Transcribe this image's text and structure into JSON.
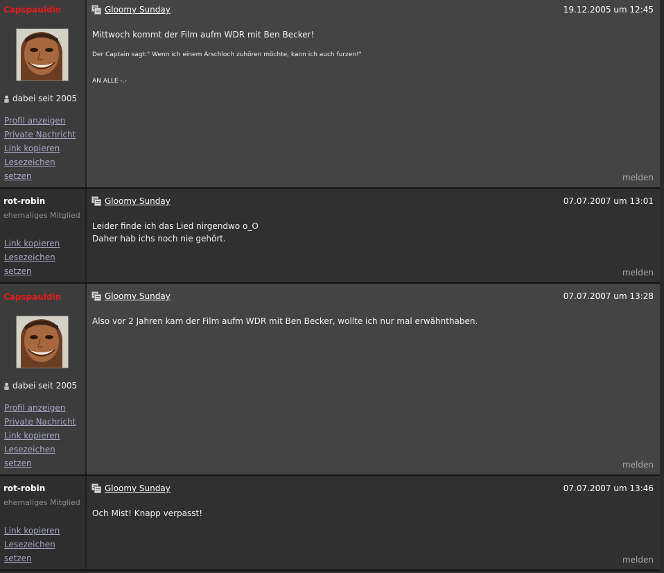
{
  "posts": [
    {
      "author": "Capspauldin",
      "since": "dabei seit 2005",
      "links": [
        "Profil anzeigen",
        "Private Nachricht",
        "Link kopieren",
        "Lesezeichen setzen"
      ],
      "title": "Gloomy Sunday",
      "date": "19.12.2005 um 12:45",
      "body": [
        "Mittwoch kommt der Film aufm WDR mit Ben Becker!",
        "Der Captain sagt:\" Wenn ich einem Arschloch zuhören möchte, kann ich auch furzen!\"",
        "AN ALLE -.-"
      ],
      "report": "melden"
    },
    {
      "author": "rot-robin",
      "role": "ehemaliges Mitglied",
      "links": [
        "Link kopieren",
        "Lesezeichen setzen"
      ],
      "title": "Gloomy Sunday",
      "date": "07.07.2007 um 13:01",
      "body": [
        "Leider finde ich das Lied nirgendwo o_O",
        "Daher hab ichs noch nie gehört."
      ],
      "report": "melden"
    },
    {
      "author": "Capspauldin",
      "since": "dabei seit 2005",
      "links": [
        "Profil anzeigen",
        "Private Nachricht",
        "Link kopieren",
        "Lesezeichen setzen"
      ],
      "title": "Gloomy Sunday",
      "date": "07.07.2007 um 13:28",
      "body": [
        "Also vor 2 Jahren kam der Film aufm WDR mit Ben Becker, wollte ich nur mal erwähnthaben."
      ],
      "report": "melden"
    },
    {
      "author": "rot-robin",
      "role": "ehemaliges Mitglied",
      "links": [
        "Link kopieren",
        "Lesezeichen setzen"
      ],
      "title": "Gloomy Sunday",
      "date": "07.07.2007 um 13:46",
      "body": [
        "Och Mist! Knapp verpasst!"
      ],
      "report": "melden"
    }
  ],
  "colors": {
    "author_highlight": "#e41b1b",
    "link": "#a7a7c8"
  },
  "icons": {
    "post": "post-icon",
    "user": "user-icon",
    "avatar": "avatar-image"
  }
}
